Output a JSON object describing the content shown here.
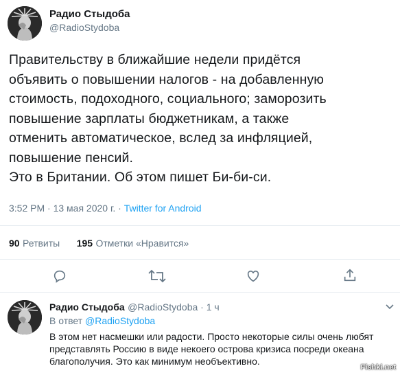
{
  "tweet": {
    "author_name": "Радио Стыдоба",
    "author_handle": "@RadioStydoba",
    "text_lines": [
      "Правительству в ближайшие недели придётся",
      "объявить о повышении налогов - на добавленную",
      "стоимость, подоходного, социального; заморозить",
      "повышение зарплаты бюджетникам, а также",
      "отменить автоматическое, вслед за инфляцией,",
      "повышение пенсий.",
      "Это в Британии. Об этом пишет Би-би-си."
    ],
    "time": "3:52 PM · 13 мая 2020 г. · ",
    "source": "Twitter for Android",
    "retweets_count": "90",
    "retweets_label": "Ретвиты",
    "likes_count": "195",
    "likes_label": "Отметки «Нравится»"
  },
  "actions": {
    "reply_icon": "reply-icon",
    "retweet_icon": "retweet-icon",
    "like_icon": "heart-icon",
    "share_icon": "share-icon"
  },
  "reply": {
    "author_name": "Радио Стыдоба",
    "author_handle": "@RadioStydoba",
    "time": " · 1 ч",
    "in_reply_prefix": "В ответ ",
    "in_reply_handle": "@RadioStydoba",
    "text_lines": [
      "В этом нет насмешки или радости. Просто некоторые силы очень любят",
      "представлять Россию в виде некоего острова кризиса посреди океана",
      "благополучия. Это как минимум необъективно."
    ]
  },
  "watermark": "Fishki.net",
  "colors": {
    "link": "#1da1f2",
    "secondary": "#657786",
    "divider": "#e6ecf0"
  }
}
